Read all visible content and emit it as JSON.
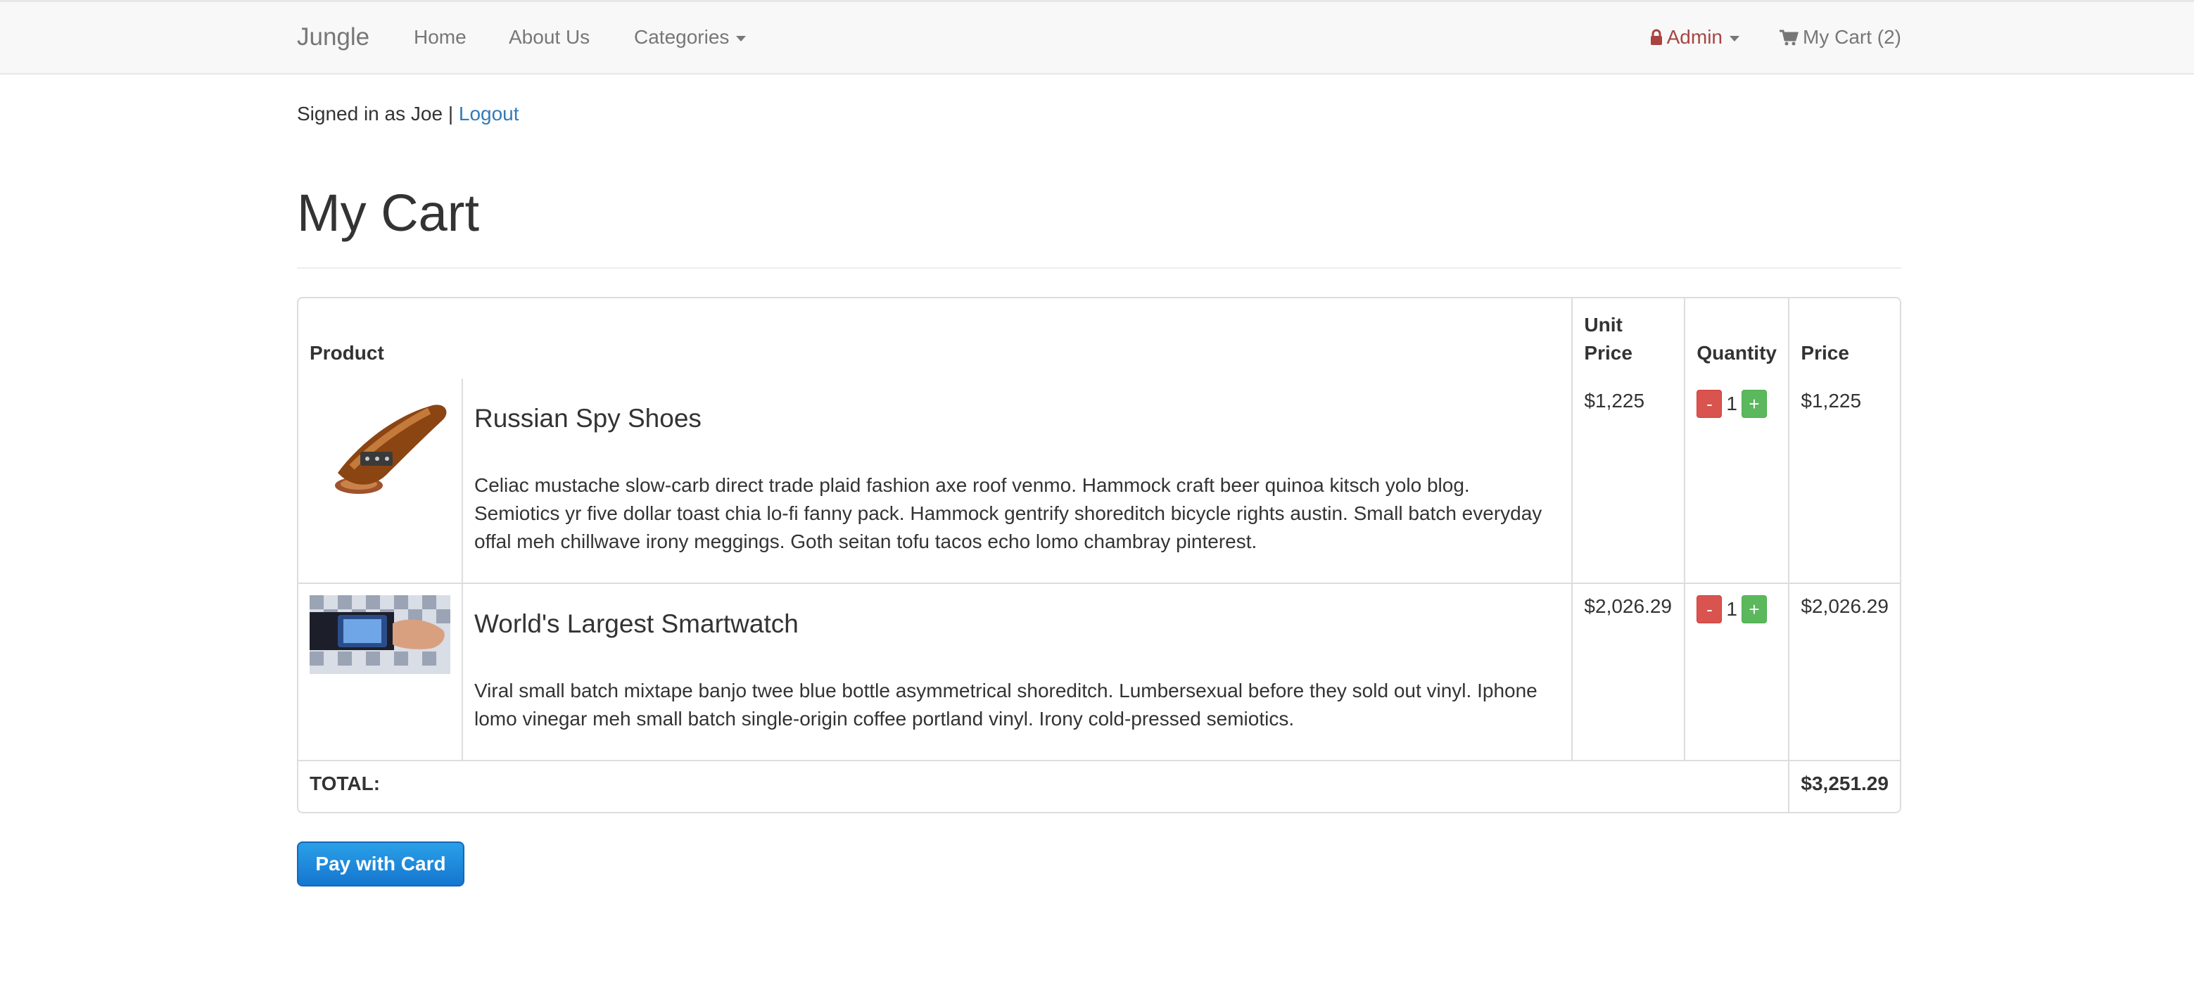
{
  "navbar": {
    "brand": "Jungle",
    "links": [
      "Home",
      "About Us",
      "Categories"
    ],
    "admin_label": "Admin",
    "cart_label": "My Cart (2)"
  },
  "session": {
    "signed_in_text": "Signed in as Joe |",
    "logout_label": "Logout"
  },
  "page": {
    "title": "My Cart"
  },
  "table": {
    "headers": {
      "product": "Product",
      "unit_price": "Unit Price",
      "quantity": "Quantity",
      "price": "Price"
    },
    "rows": [
      {
        "name": "Russian Spy Shoes",
        "description": "Celiac mustache slow-carb direct trade plaid fashion axe roof venmo. Hammock craft beer quinoa kitsch yolo blog. Semiotics yr five dollar toast chia lo-fi fanny pack. Hammock gentrify shoreditch bicycle rights austin. Small batch everyday offal meh chillwave irony meggings. Goth seitan tofu tacos echo lomo chambray pinterest.",
        "unit_price": "$1,225",
        "quantity": "1",
        "price": "$1,225"
      },
      {
        "name": "World's Largest Smartwatch",
        "description": "Viral small batch mixtape banjo twee blue bottle asymmetrical shoreditch. Lumbersexual before they sold out vinyl. Iphone lomo vinegar meh small batch single-origin coffee portland vinyl. Irony cold-pressed semiotics.",
        "unit_price": "$2,026.29",
        "quantity": "1",
        "price": "$2,026.29"
      }
    ],
    "total_label": "TOTAL:",
    "total_value": "$3,251.29",
    "minus_label": "-",
    "plus_label": "+"
  },
  "pay_button": "Pay with Card",
  "colors": {
    "link": "#337ab7",
    "admin": "#a94442",
    "danger": "#d9534f",
    "success": "#5cb85c",
    "pay": "#1a8ad9"
  },
  "icons": {
    "admin": "lock-icon",
    "cart": "shopping-cart-icon"
  }
}
